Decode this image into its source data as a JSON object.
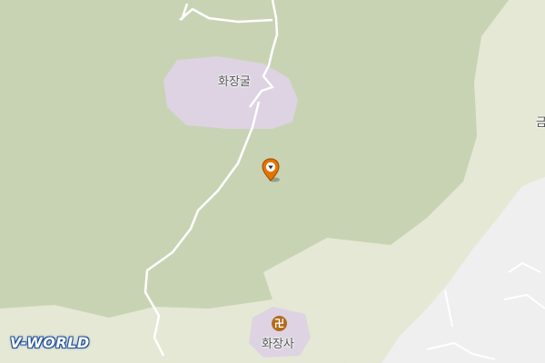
{
  "map": {
    "labels": {
      "cave": "화장굴",
      "temple": "화장사",
      "edge_partial": "금"
    },
    "icons": {
      "temple": "buddhist-temple-icon",
      "marker": "location-pin-icon"
    },
    "brand_logo": "V-WORLD",
    "colors": {
      "forest": "#c8d3b4",
      "open_land": "#e7e9d6",
      "urban": "#eeeeee",
      "facility": "#ddd3e2",
      "marker": "#e67300"
    }
  }
}
